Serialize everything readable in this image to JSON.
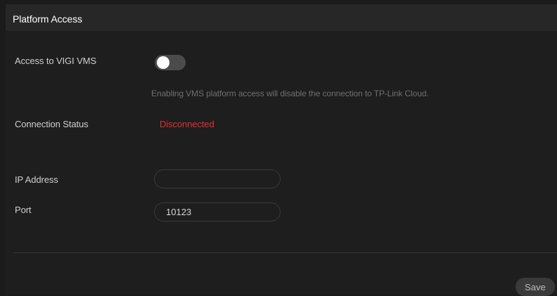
{
  "header": {
    "title": "Platform Access"
  },
  "vms_access": {
    "label": "Access to VIGI VMS",
    "enabled": false,
    "hint": "Enabling VMS platform access will disable the connection to TP-Link Cloud."
  },
  "connection": {
    "label": "Connection Status",
    "status": "Disconnected",
    "status_color": "#e62e2e"
  },
  "ip_address": {
    "label": "IP Address",
    "value": ""
  },
  "port": {
    "label": "Port",
    "value": "10123"
  },
  "footer": {
    "save_label": "Save"
  }
}
